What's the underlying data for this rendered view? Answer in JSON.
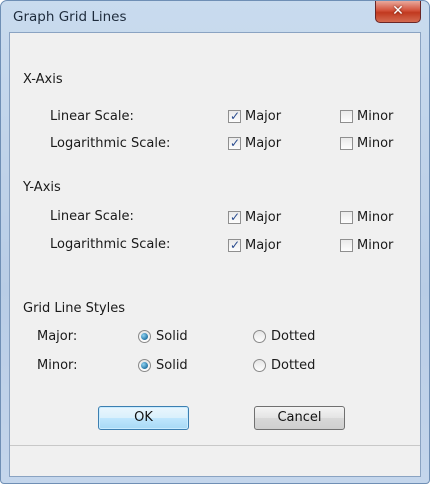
{
  "window": {
    "title": "Graph Grid Lines",
    "close_glyph": "✕"
  },
  "x_axis": {
    "heading": "X-Axis",
    "rows": [
      {
        "label": "Linear Scale:",
        "major_label": "Major",
        "major_checked": true,
        "minor_label": "Minor",
        "minor_checked": false
      },
      {
        "label": "Logarithmic Scale:",
        "major_label": "Major",
        "major_checked": true,
        "minor_label": "Minor",
        "minor_checked": false
      }
    ]
  },
  "y_axis": {
    "heading": "Y-Axis",
    "rows": [
      {
        "label": "Linear Scale:",
        "major_label": "Major",
        "major_checked": true,
        "minor_label": "Minor",
        "minor_checked": false
      },
      {
        "label": "Logarithmic Scale:",
        "major_label": "Major",
        "major_checked": true,
        "minor_label": "Minor",
        "minor_checked": false
      }
    ]
  },
  "styles": {
    "heading": "Grid Line Styles",
    "rows": [
      {
        "label": "Major:",
        "solid_label": "Solid",
        "dotted_label": "Dotted",
        "selected": "Solid"
      },
      {
        "label": "Minor:",
        "solid_label": "Solid",
        "dotted_label": "Dotted",
        "selected": "Solid"
      }
    ]
  },
  "buttons": {
    "ok_label": "OK",
    "cancel_label": "Cancel"
  },
  "colors": {
    "titlebar": "#c9dbee",
    "close_button": "#c1391f",
    "default_button": "#a7d9f5",
    "radio_fill": "#1d6ea0"
  }
}
